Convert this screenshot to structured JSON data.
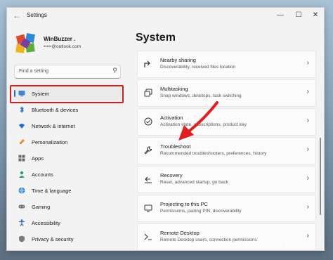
{
  "window": {
    "title": "Settings",
    "back_icon": "arrow-left-icon"
  },
  "user": {
    "name": "WinBuzzer .",
    "email": "•••••@outlook.com"
  },
  "search": {
    "placeholder": "Find a setting"
  },
  "nav": [
    {
      "label": "System",
      "icon": "monitor-icon",
      "active": true
    },
    {
      "label": "Bluetooth & devices",
      "icon": "bluetooth-icon"
    },
    {
      "label": "Network & internet",
      "icon": "wifi-icon"
    },
    {
      "label": "Personalization",
      "icon": "brush-icon"
    },
    {
      "label": "Apps",
      "icon": "apps-icon"
    },
    {
      "label": "Accounts",
      "icon": "person-icon"
    },
    {
      "label": "Time & language",
      "icon": "globe-icon"
    },
    {
      "label": "Gaming",
      "icon": "gamepad-icon"
    },
    {
      "label": "Accessibility",
      "icon": "accessibility-icon"
    },
    {
      "label": "Privacy & security",
      "icon": "shield-icon"
    }
  ],
  "page": {
    "title": "System",
    "cards": [
      {
        "title": "Nearby sharing",
        "subtitle": "Discoverability, received files location",
        "icon": "share-icon"
      },
      {
        "title": "Multitasking",
        "subtitle": "Snap windows, desktops, task switching",
        "icon": "multitask-icon"
      },
      {
        "title": "Activation",
        "subtitle": "Activation state, subscriptions, product key",
        "icon": "check-circle-icon"
      },
      {
        "title": "Troubleshoot",
        "subtitle": "Recommended troubleshooters, preferences, history",
        "icon": "wrench-icon"
      },
      {
        "title": "Recovery",
        "subtitle": "Reset, advanced startup, go back",
        "icon": "recovery-icon"
      },
      {
        "title": "Projecting to this PC",
        "subtitle": "Permissions, pairing PIN, discoverability",
        "icon": "projector-icon"
      },
      {
        "title": "Remote Desktop",
        "subtitle": "Remote Desktop users, connection permissions",
        "icon": "remote-icon"
      }
    ]
  },
  "watermark": "WinBuzzer",
  "colors": {
    "accent": "#2b6fd0",
    "highlight": "#d41e1e"
  }
}
